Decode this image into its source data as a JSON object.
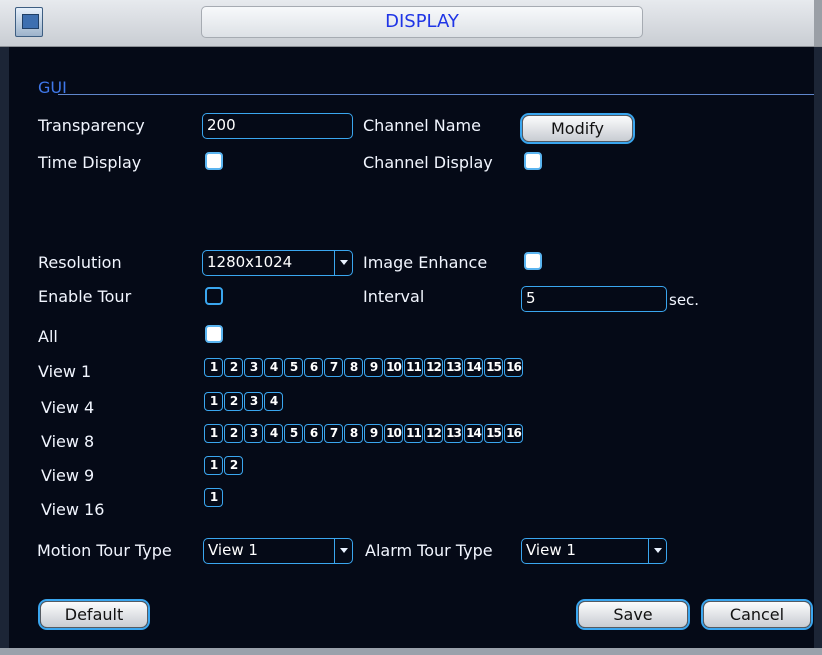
{
  "window": {
    "title": "DISPLAY"
  },
  "gui": {
    "section_label": "GUI",
    "transparency_label": "Transparency",
    "transparency_value": "200",
    "channel_name_label": "Channel Name",
    "modify_label": "Modify",
    "time_display_label": "Time Display",
    "time_display_checked": true,
    "channel_display_label": "Channel Display",
    "channel_display_checked": true,
    "resolution_label": "Resolution",
    "resolution_value": "1280x1024",
    "image_enhance_label": "Image Enhance",
    "image_enhance_checked": true
  },
  "tour": {
    "enable_label": "Enable Tour",
    "enable_checked": false,
    "interval_label": "Interval",
    "interval_value": "5",
    "interval_unit": "sec.",
    "all_label": "All",
    "all_checked": true,
    "views": [
      {
        "label": "View 1",
        "channels": [
          "1",
          "2",
          "3",
          "4",
          "5",
          "6",
          "7",
          "8",
          "9",
          "10",
          "11",
          "12",
          "13",
          "14",
          "15",
          "16"
        ]
      },
      {
        "label": "View 4",
        "channels": [
          "1",
          "2",
          "3",
          "4"
        ]
      },
      {
        "label": "View 8",
        "channels": [
          "1",
          "2",
          "3",
          "4",
          "5",
          "6",
          "7",
          "8",
          "9",
          "10",
          "11",
          "12",
          "13",
          "14",
          "15",
          "16"
        ]
      },
      {
        "label": "View 9",
        "channels": [
          "1",
          "2"
        ]
      },
      {
        "label": "View 16",
        "channels": [
          "1"
        ]
      }
    ],
    "motion_tour_type_label": "Motion Tour Type",
    "motion_tour_type_value": "View 1",
    "alarm_tour_type_label": "Alarm Tour Type",
    "alarm_tour_type_value": "View 1"
  },
  "buttons": {
    "default": "Default",
    "save": "Save",
    "cancel": "Cancel"
  },
  "colors": {
    "accent": "#3aa6ef",
    "title_text": "#1f35e6",
    "section_label": "#3f78ea",
    "background": "#050a17"
  }
}
